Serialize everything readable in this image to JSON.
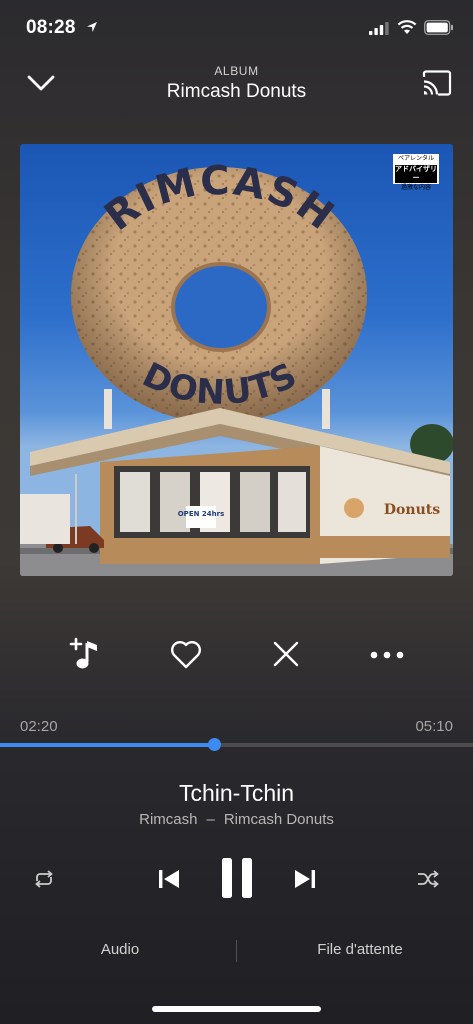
{
  "status_bar": {
    "time": "08:28"
  },
  "header": {
    "subtitle": "ALBUM",
    "title": "Rimcash Donuts"
  },
  "artwork": {
    "sign_top": "RIMCASH",
    "sign_bottom": "DONUTS",
    "window_sign": "OPEN 24hrs",
    "wall_text": "Donuts",
    "advisory_top": "ペアレンタル",
    "advisory_mid": "アドバイザリー",
    "advisory_bottom": "過激な内容"
  },
  "actions": [
    "add-to-playlist-icon",
    "heart-icon",
    "close-icon",
    "more-icon"
  ],
  "progress": {
    "elapsed": "02:20",
    "total": "05:10",
    "fraction": 0.452
  },
  "track": {
    "title": "Tchin-Tchin",
    "artist": "Rimcash",
    "separator": "–",
    "album": "Rimcash Donuts"
  },
  "controls": [
    "repeat-icon",
    "previous-icon",
    "pause-icon",
    "next-icon",
    "shuffle-icon"
  ],
  "tabs": {
    "audio": "Audio",
    "queue": "File d'attente"
  },
  "colors": {
    "accent": "#3d8af1"
  }
}
